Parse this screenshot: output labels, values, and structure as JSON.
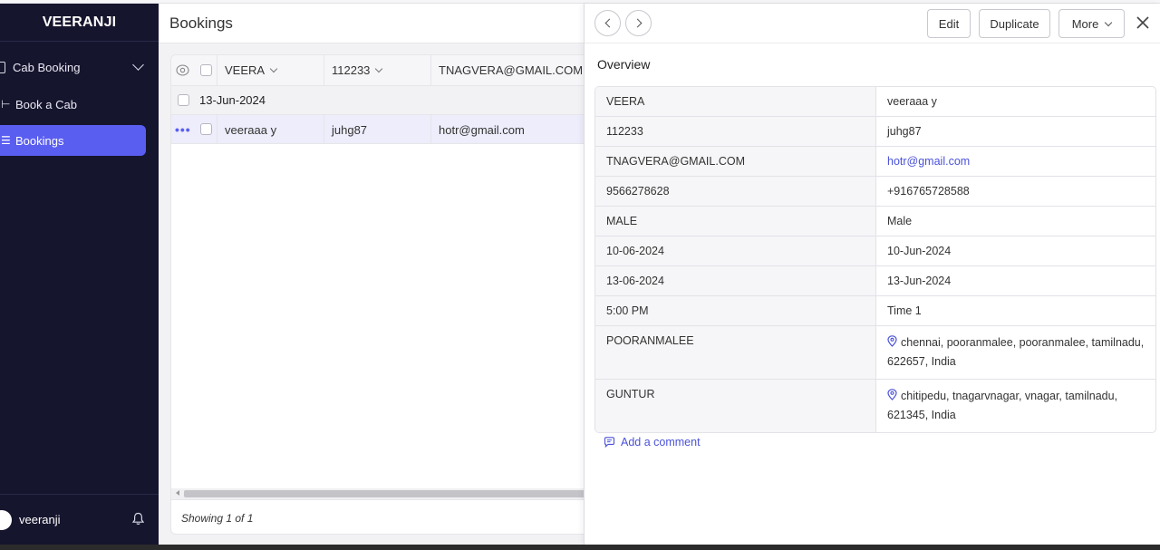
{
  "sidebar": {
    "brand": "VEERANJI",
    "group_label": "Cab Booking",
    "items": [
      {
        "label": "Book a Cab",
        "icon": "route-icon"
      },
      {
        "label": "Bookings",
        "icon": "list-icon",
        "active": true
      }
    ],
    "user_name": "veeranji"
  },
  "main": {
    "title": "Bookings",
    "columns": [
      "VEERA",
      "112233",
      "TNAGVERA@GMAIL.COM"
    ],
    "group_label": "13-Jun-2024",
    "row": {
      "veera": "veeraaa y",
      "code": "juhg87",
      "email": "hotr@gmail.com"
    },
    "footer": "Showing 1 of 1"
  },
  "panel": {
    "buttons": {
      "edit": "Edit",
      "duplicate": "Duplicate",
      "more": "More"
    },
    "overview_title": "Overview",
    "fields": [
      {
        "key": "VEERA",
        "value": "veeraaa y"
      },
      {
        "key": "112233",
        "value": "juhg87"
      },
      {
        "key": "TNAGVERA@GMAIL.COM",
        "value": "hotr@gmail.com",
        "link": true
      },
      {
        "key": "9566278628",
        "value": "+916765728588"
      },
      {
        "key": "MALE",
        "value": "Male"
      },
      {
        "key": "10-06-2024",
        "value": "10-Jun-2024"
      },
      {
        "key": "13-06-2024",
        "value": "13-Jun-2024"
      },
      {
        "key": "5:00 PM",
        "value": "Time 1"
      },
      {
        "key": "POORANMALEE",
        "value_line1": "chennai, pooranmalee, pooranmalee, tamilnadu,",
        "value_line2": "622657, India",
        "location": true
      },
      {
        "key": "GUNTUR",
        "value_line1": "chitipedu, tnagarvnagar, vnagar, tamilnadu,",
        "value_line2": "621345, India",
        "location": true
      }
    ],
    "add_comment": "Add a comment"
  },
  "colors": {
    "accent": "#5a5ef0",
    "sidebar_bg": "#16152e",
    "link": "#4a52d8"
  }
}
